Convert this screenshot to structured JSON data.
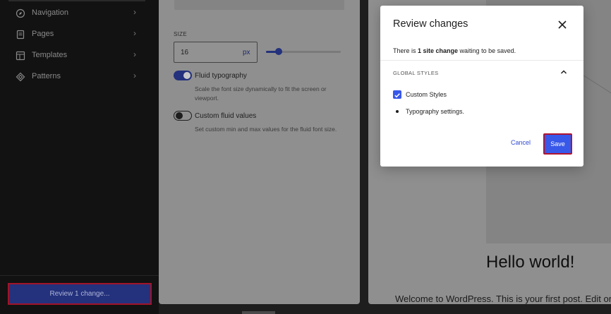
{
  "sidebar": {
    "items": [
      {
        "label": "Navigation",
        "icon": "navigation-icon"
      },
      {
        "label": "Pages",
        "icon": "pages-icon"
      },
      {
        "label": "Templates",
        "icon": "templates-icon"
      },
      {
        "label": "Patterns",
        "icon": "patterns-icon"
      }
    ],
    "review_button": "Review 1 change..."
  },
  "typography_panel": {
    "size_label": "SIZE",
    "size_value": "16",
    "size_unit": "px",
    "fluid_typography": {
      "label": "Fluid typography",
      "help": "Scale the font size dynamically to fit the screen or viewport.",
      "enabled": true
    },
    "custom_fluid": {
      "label": "Custom fluid values",
      "help": "Set custom min and max values for the fluid font size.",
      "enabled": false
    }
  },
  "preview": {
    "heading": "Hello world!",
    "text": "Welcome to WordPress. This is your first post. Edit or"
  },
  "modal": {
    "title": "Review changes",
    "message_prefix": "There is ",
    "message_bold": "1 site change",
    "message_suffix": " waiting to be saved.",
    "section_label": "GLOBAL STYLES",
    "checkbox_label": "Custom Styles",
    "checkbox_checked": true,
    "bullet_item": "Typography settings.",
    "cancel_label": "Cancel",
    "save_label": "Save"
  },
  "colors": {
    "accent": "#3858e9",
    "highlight_border": "#b01530"
  }
}
